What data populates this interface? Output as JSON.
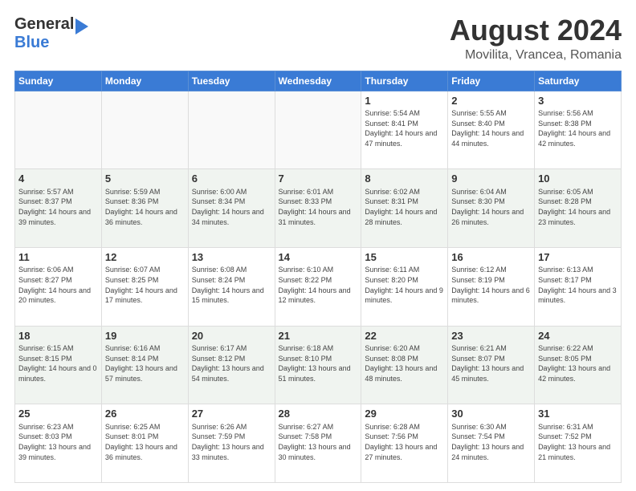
{
  "header": {
    "logo_line1": "General",
    "logo_line2": "Blue",
    "month": "August 2024",
    "location": "Movilita, Vrancea, Romania"
  },
  "weekdays": [
    "Sunday",
    "Monday",
    "Tuesday",
    "Wednesday",
    "Thursday",
    "Friday",
    "Saturday"
  ],
  "weeks": [
    [
      {
        "day": "",
        "info": ""
      },
      {
        "day": "",
        "info": ""
      },
      {
        "day": "",
        "info": ""
      },
      {
        "day": "",
        "info": ""
      },
      {
        "day": "1",
        "info": "Sunrise: 5:54 AM\nSunset: 8:41 PM\nDaylight: 14 hours and 47 minutes."
      },
      {
        "day": "2",
        "info": "Sunrise: 5:55 AM\nSunset: 8:40 PM\nDaylight: 14 hours and 44 minutes."
      },
      {
        "day": "3",
        "info": "Sunrise: 5:56 AM\nSunset: 8:38 PM\nDaylight: 14 hours and 42 minutes."
      }
    ],
    [
      {
        "day": "4",
        "info": "Sunrise: 5:57 AM\nSunset: 8:37 PM\nDaylight: 14 hours and 39 minutes."
      },
      {
        "day": "5",
        "info": "Sunrise: 5:59 AM\nSunset: 8:36 PM\nDaylight: 14 hours and 36 minutes."
      },
      {
        "day": "6",
        "info": "Sunrise: 6:00 AM\nSunset: 8:34 PM\nDaylight: 14 hours and 34 minutes."
      },
      {
        "day": "7",
        "info": "Sunrise: 6:01 AM\nSunset: 8:33 PM\nDaylight: 14 hours and 31 minutes."
      },
      {
        "day": "8",
        "info": "Sunrise: 6:02 AM\nSunset: 8:31 PM\nDaylight: 14 hours and 28 minutes."
      },
      {
        "day": "9",
        "info": "Sunrise: 6:04 AM\nSunset: 8:30 PM\nDaylight: 14 hours and 26 minutes."
      },
      {
        "day": "10",
        "info": "Sunrise: 6:05 AM\nSunset: 8:28 PM\nDaylight: 14 hours and 23 minutes."
      }
    ],
    [
      {
        "day": "11",
        "info": "Sunrise: 6:06 AM\nSunset: 8:27 PM\nDaylight: 14 hours and 20 minutes."
      },
      {
        "day": "12",
        "info": "Sunrise: 6:07 AM\nSunset: 8:25 PM\nDaylight: 14 hours and 17 minutes."
      },
      {
        "day": "13",
        "info": "Sunrise: 6:08 AM\nSunset: 8:24 PM\nDaylight: 14 hours and 15 minutes."
      },
      {
        "day": "14",
        "info": "Sunrise: 6:10 AM\nSunset: 8:22 PM\nDaylight: 14 hours and 12 minutes."
      },
      {
        "day": "15",
        "info": "Sunrise: 6:11 AM\nSunset: 8:20 PM\nDaylight: 14 hours and 9 minutes."
      },
      {
        "day": "16",
        "info": "Sunrise: 6:12 AM\nSunset: 8:19 PM\nDaylight: 14 hours and 6 minutes."
      },
      {
        "day": "17",
        "info": "Sunrise: 6:13 AM\nSunset: 8:17 PM\nDaylight: 14 hours and 3 minutes."
      }
    ],
    [
      {
        "day": "18",
        "info": "Sunrise: 6:15 AM\nSunset: 8:15 PM\nDaylight: 14 hours and 0 minutes."
      },
      {
        "day": "19",
        "info": "Sunrise: 6:16 AM\nSunset: 8:14 PM\nDaylight: 13 hours and 57 minutes."
      },
      {
        "day": "20",
        "info": "Sunrise: 6:17 AM\nSunset: 8:12 PM\nDaylight: 13 hours and 54 minutes."
      },
      {
        "day": "21",
        "info": "Sunrise: 6:18 AM\nSunset: 8:10 PM\nDaylight: 13 hours and 51 minutes."
      },
      {
        "day": "22",
        "info": "Sunrise: 6:20 AM\nSunset: 8:08 PM\nDaylight: 13 hours and 48 minutes."
      },
      {
        "day": "23",
        "info": "Sunrise: 6:21 AM\nSunset: 8:07 PM\nDaylight: 13 hours and 45 minutes."
      },
      {
        "day": "24",
        "info": "Sunrise: 6:22 AM\nSunset: 8:05 PM\nDaylight: 13 hours and 42 minutes."
      }
    ],
    [
      {
        "day": "25",
        "info": "Sunrise: 6:23 AM\nSunset: 8:03 PM\nDaylight: 13 hours and 39 minutes."
      },
      {
        "day": "26",
        "info": "Sunrise: 6:25 AM\nSunset: 8:01 PM\nDaylight: 13 hours and 36 minutes."
      },
      {
        "day": "27",
        "info": "Sunrise: 6:26 AM\nSunset: 7:59 PM\nDaylight: 13 hours and 33 minutes."
      },
      {
        "day": "28",
        "info": "Sunrise: 6:27 AM\nSunset: 7:58 PM\nDaylight: 13 hours and 30 minutes."
      },
      {
        "day": "29",
        "info": "Sunrise: 6:28 AM\nSunset: 7:56 PM\nDaylight: 13 hours and 27 minutes."
      },
      {
        "day": "30",
        "info": "Sunrise: 6:30 AM\nSunset: 7:54 PM\nDaylight: 13 hours and 24 minutes."
      },
      {
        "day": "31",
        "info": "Sunrise: 6:31 AM\nSunset: 7:52 PM\nDaylight: 13 hours and 21 minutes."
      }
    ]
  ]
}
